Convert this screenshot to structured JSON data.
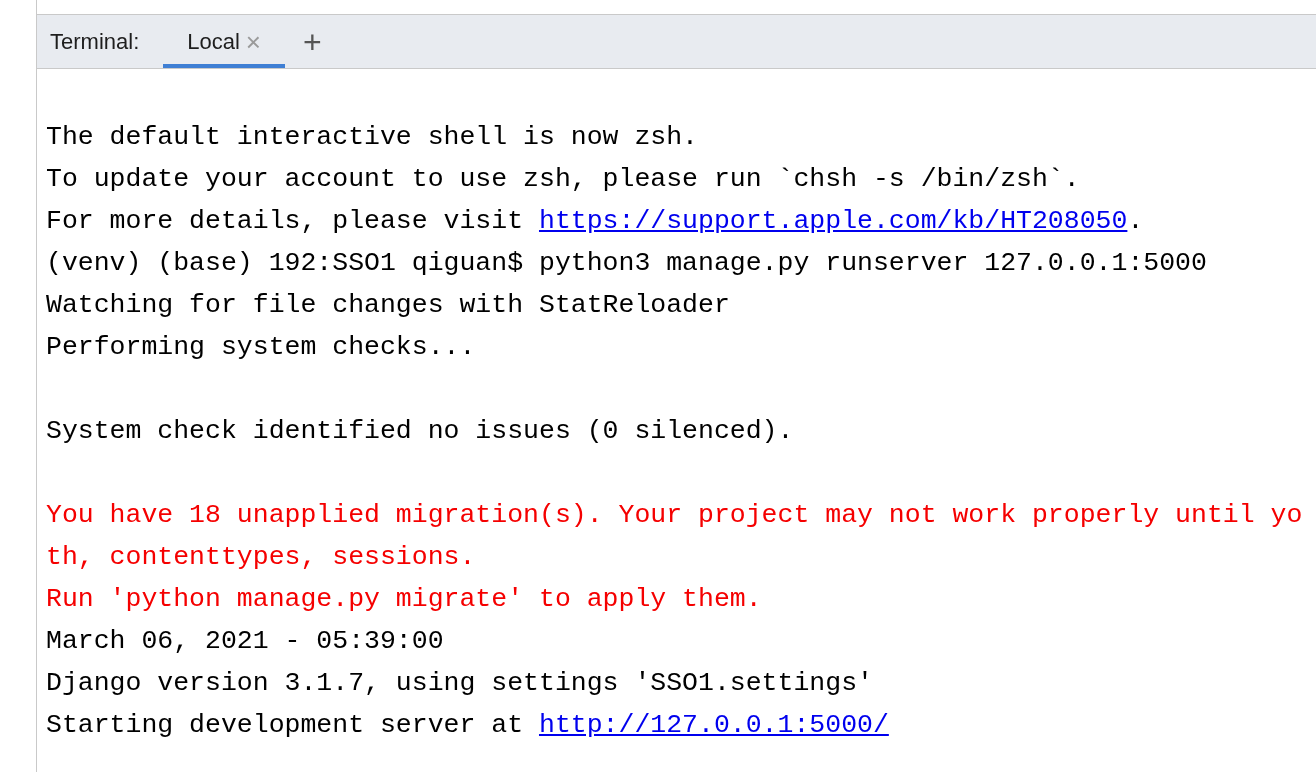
{
  "tool_window": {
    "title": "Terminal:",
    "tabs": [
      {
        "label": "Local",
        "close": "×",
        "selected": true
      }
    ],
    "add_tab": "+"
  },
  "terminal": {
    "lines": [
      {
        "kind": "blank"
      },
      {
        "kind": "text",
        "segments": [
          {
            "kind": "plain",
            "text": "The default interactive shell is now zsh."
          }
        ]
      },
      {
        "kind": "text",
        "segments": [
          {
            "kind": "plain",
            "text": "To update your account to use zsh, please run `chsh -s /bin/zsh`."
          }
        ]
      },
      {
        "kind": "text",
        "segments": [
          {
            "kind": "plain",
            "text": "For more details, please visit "
          },
          {
            "kind": "link",
            "text": "https://support.apple.com/kb/HT208050"
          },
          {
            "kind": "plain",
            "text": "."
          }
        ]
      },
      {
        "kind": "text",
        "segments": [
          {
            "kind": "plain",
            "text": "(venv) (base) 192:SSO1 qiguan$ python3 manage.py runserver 127.0.0.1:5000"
          }
        ]
      },
      {
        "kind": "text",
        "segments": [
          {
            "kind": "plain",
            "text": "Watching for file changes with StatReloader"
          }
        ]
      },
      {
        "kind": "text",
        "segments": [
          {
            "kind": "plain",
            "text": "Performing system checks..."
          }
        ]
      },
      {
        "kind": "blank"
      },
      {
        "kind": "text",
        "segments": [
          {
            "kind": "plain",
            "text": "System check identified no issues (0 silenced)."
          }
        ]
      },
      {
        "kind": "blank"
      },
      {
        "kind": "text",
        "segments": [
          {
            "kind": "error",
            "text": "You have 18 unapplied migration(s). Your project may not work properly until yo"
          }
        ]
      },
      {
        "kind": "text",
        "segments": [
          {
            "kind": "error",
            "text": "th, contenttypes, sessions."
          }
        ]
      },
      {
        "kind": "text",
        "segments": [
          {
            "kind": "error",
            "text": "Run 'python manage.py migrate' to apply them."
          }
        ]
      },
      {
        "kind": "text",
        "segments": [
          {
            "kind": "plain",
            "text": "March 06, 2021 - 05:39:00"
          }
        ]
      },
      {
        "kind": "text",
        "segments": [
          {
            "kind": "plain",
            "text": "Django version 3.1.7, using settings 'SSO1.settings'"
          }
        ]
      },
      {
        "kind": "text",
        "segments": [
          {
            "kind": "plain",
            "text": "Starting development server at "
          },
          {
            "kind": "link",
            "text": "http://127.0.0.1:5000/"
          }
        ]
      }
    ]
  }
}
